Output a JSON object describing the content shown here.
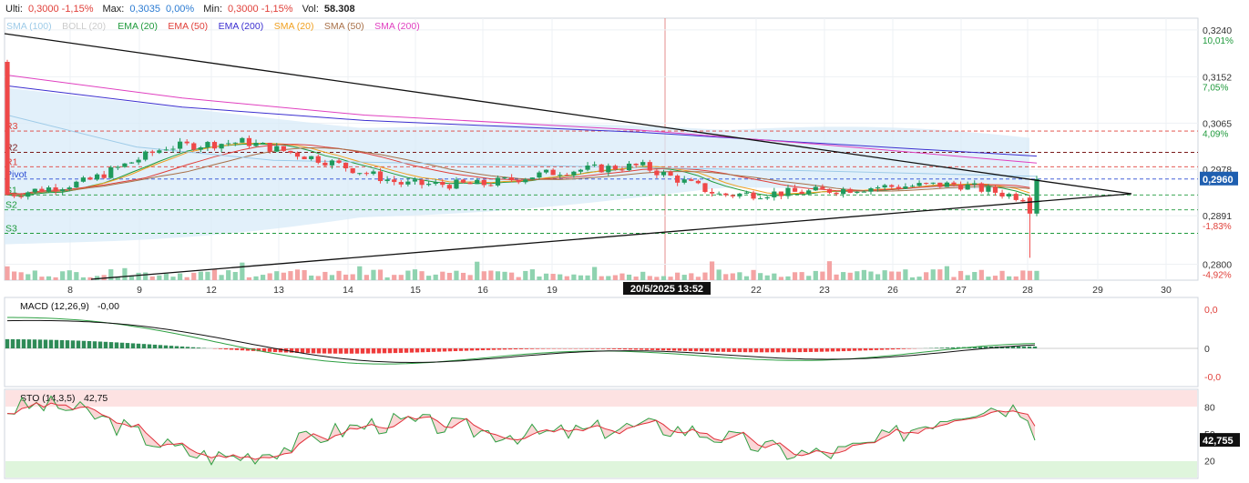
{
  "header": {
    "last_label": "Ulti:",
    "last_value": "0,3000 -1,15%",
    "max_label": "Max:",
    "max_value": "0,3035",
    "max_change": "0,00%",
    "min_label": "Min:",
    "min_value": "0,3000 -1,15%",
    "vol_label": "Vol:",
    "vol_value": "58.308"
  },
  "legend": [
    {
      "text": "SMA (100)",
      "color": "#9ecbe8"
    },
    {
      "text": "BOLL (20)",
      "color": "#cccccc"
    },
    {
      "text": "EMA (20)",
      "color": "#1f9a3c"
    },
    {
      "text": "EMA (50)",
      "color": "#e0403a"
    },
    {
      "text": "EMA (200)",
      "color": "#3b2fd0"
    },
    {
      "text": "SMA (20)",
      "color": "#f0a020"
    },
    {
      "text": "SMA (50)",
      "color": "#a87048"
    },
    {
      "text": "SMA (200)",
      "color": "#e040c0"
    }
  ],
  "price_axis": [
    {
      "price": 0.324,
      "label": "0,3240",
      "pct": "10,01%"
    },
    {
      "price": 0.3152,
      "label": "0,3152",
      "pct": "7,05%"
    },
    {
      "price": 0.3065,
      "label": "0,3065",
      "pct": "4,09%"
    },
    {
      "price": 0.2978,
      "label": "0,2978",
      "pct": ""
    },
    {
      "price": 0.2891,
      "label": "0,2891",
      "pct": "-1,83%"
    },
    {
      "price": 0.28,
      "label": "0,2800",
      "pct": "-4,92%"
    }
  ],
  "current_price_badge": "0,2960",
  "pivot_levels": [
    {
      "name": "R3",
      "price": 0.305,
      "color": "#e0403a"
    },
    {
      "name": "R2",
      "price": 0.301,
      "color": "#7a1a1a"
    },
    {
      "name": "R1",
      "price": 0.2983,
      "color": "#e0403a"
    },
    {
      "name": "Pivot",
      "price": 0.296,
      "color": "#2b4bd2"
    },
    {
      "name": "S1",
      "price": 0.293,
      "color": "#1f9a3c"
    },
    {
      "name": "S2",
      "price": 0.2902,
      "color": "#1f9a3c"
    },
    {
      "name": "S3",
      "price": 0.2858,
      "color": "#1f9a3c"
    }
  ],
  "x_axis_labels": [
    "8",
    "9",
    "12",
    "13",
    "14",
    "15",
    "16",
    "19",
    "22",
    "23",
    "26",
    "27",
    "28",
    "29",
    "30"
  ],
  "crosshair_label": "20/5/2025 13:52",
  "macd_panel": {
    "title": "MACD (12,26,9)",
    "value": "-0,00",
    "axis": [
      "0,0",
      "0",
      "-0,0"
    ]
  },
  "sto_panel": {
    "title": "STO (14,3,5)",
    "value": "42,75",
    "axis": [
      "80",
      "50",
      "20"
    ],
    "badge": "42,755"
  },
  "chart_data": {
    "type": "candlestick",
    "instrument_last": 0.3,
    "price_range": [
      0.277,
      0.3262
    ],
    "days": [
      "8",
      "9",
      "12",
      "13",
      "14",
      "15",
      "16",
      "19",
      "20",
      "22",
      "23",
      "26",
      "27",
      "28"
    ],
    "daily_close_approx": [
      0.293,
      0.2955,
      0.302,
      0.303,
      0.2995,
      0.295,
      0.295,
      0.2975,
      0.2985,
      0.293,
      0.2935,
      0.2945,
      0.295,
      0.292
    ],
    "macd_trend": "positive early, negative mid-month, near zero late",
    "stochastic_last": 42.75,
    "grid": true
  }
}
